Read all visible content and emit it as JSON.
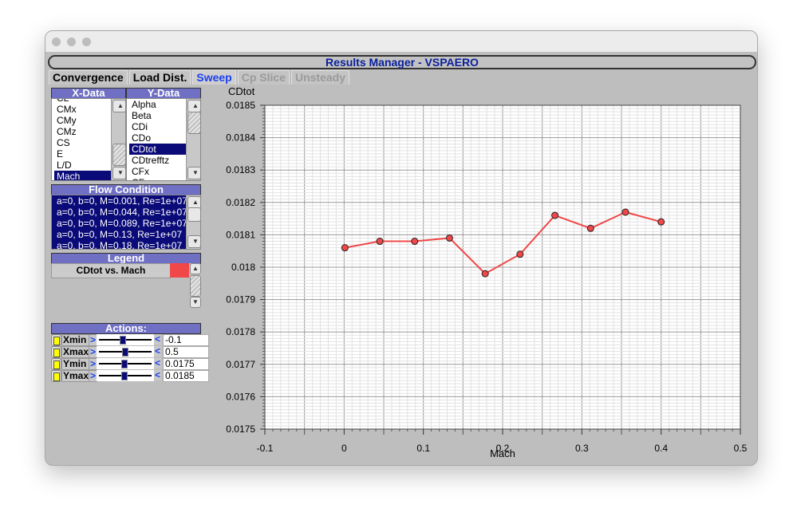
{
  "window": {
    "title": "Results Manager - VSPAERO"
  },
  "tabs": [
    {
      "label": "Convergence",
      "state": "normal"
    },
    {
      "label": "Load Dist.",
      "state": "normal"
    },
    {
      "label": "Sweep",
      "state": "active"
    },
    {
      "label": "Cp Slice",
      "state": "disabled"
    },
    {
      "label": "Unsteady",
      "state": "disabled"
    }
  ],
  "xdata": {
    "header": "X-Data",
    "items": [
      "CL",
      "CMx",
      "CMy",
      "CMz",
      "CS",
      "E",
      "L/D",
      "Mach"
    ],
    "selected": "Mach"
  },
  "ydata": {
    "header": "Y-Data",
    "items": [
      "Alpha",
      "Beta",
      "CDi",
      "CDo",
      "CDtot",
      "CDtrefftz",
      "CFx",
      "CFy"
    ],
    "selected": "CDtot"
  },
  "flow": {
    "header": "Flow Condition",
    "items": [
      "a=0, b=0, M=0.001, Re=1e+07",
      "a=0, b=0, M=0.044, Re=1e+07",
      "a=0, b=0, M=0.089, Re=1e+07",
      "a=0, b=0, M=0.13, Re=1e+07",
      "a=0, b=0, M=0.18, Re=1e+07"
    ]
  },
  "legend": {
    "header": "Legend",
    "entries": [
      {
        "label": "CDtot vs. Mach",
        "color": "#f04848"
      }
    ]
  },
  "actions": {
    "header": "Actions:",
    "rows": [
      {
        "label": "Xmin",
        "value": "-0.1",
        "slider": 0.45
      },
      {
        "label": "Xmax",
        "value": "0.5",
        "slider": 0.5
      },
      {
        "label": "Ymin",
        "value": "0.0175",
        "slider": 0.48
      },
      {
        "label": "Ymax",
        "value": "0.0185",
        "slider": 0.48
      }
    ]
  },
  "chart_data": {
    "type": "line",
    "xlabel": "Mach",
    "ylabel": "CDtot",
    "xlim": [
      -0.1,
      0.5
    ],
    "ylim": [
      0.0175,
      0.0185
    ],
    "xticks": [
      "-0.1",
      "0",
      "0.1",
      "0.2",
      "0.3",
      "0.4",
      "0.5"
    ],
    "yticks": [
      "0.0175",
      "0.0176",
      "0.0177",
      "0.0178",
      "0.0179",
      "0.018",
      "0.0181",
      "0.0182",
      "0.0183",
      "0.0184",
      "0.0185"
    ],
    "grid": true,
    "series": [
      {
        "color": "#f04848",
        "x": [
          0.001,
          0.045,
          0.089,
          0.133,
          0.178,
          0.222,
          0.266,
          0.311,
          0.355,
          0.4
        ],
        "y": [
          0.01806,
          0.01808,
          0.01808,
          0.01809,
          0.01798,
          0.01804,
          0.01816,
          0.01812,
          0.01817,
          0.01814
        ]
      }
    ]
  }
}
